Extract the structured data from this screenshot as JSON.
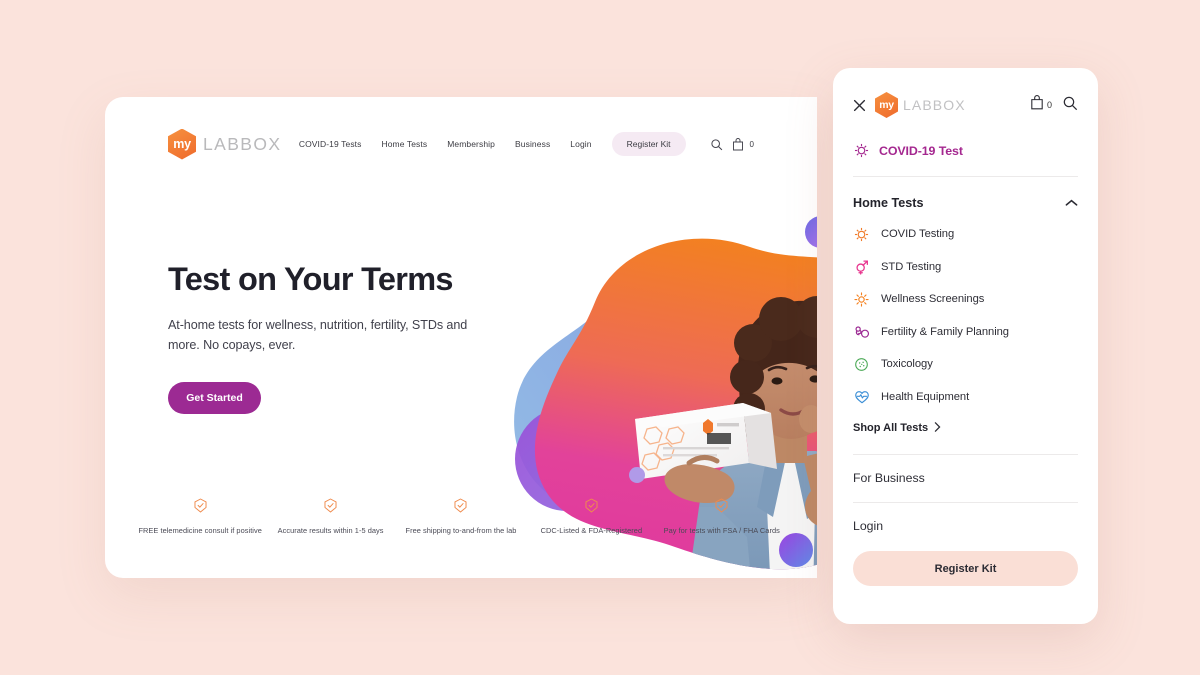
{
  "theme": {
    "page_bg": "#fbe3dc",
    "brand_orange": "#ef6a2c",
    "brand_purple": "#9c2a93",
    "magenta": "#a4278f",
    "pill_pink": "#fadfd6"
  },
  "desktop": {
    "logo": {
      "mark_text": "my",
      "word": "LABBOX"
    },
    "nav": {
      "links": [
        {
          "label": "COVID-19 Tests"
        },
        {
          "label": "Home Tests"
        },
        {
          "label": "Membership"
        },
        {
          "label": "Business"
        },
        {
          "label": "Login"
        }
      ],
      "register_kit": "Register Kit",
      "search_icon": "search-icon",
      "cart_icon": "shopping-bag-icon",
      "cart_count": "0"
    },
    "hero": {
      "title": "Test on Your Terms",
      "subtitle": "At-home tests for wellness, nutrition, fertility, STDs and more. No copays, ever.",
      "cta": "Get Started"
    },
    "features": [
      {
        "icon": "check-shield-icon",
        "text": "FREE telemedicine consult if positive"
      },
      {
        "icon": "check-shield-icon",
        "text": "Accurate results within 1-5 days"
      },
      {
        "icon": "check-shield-icon",
        "text": "Free shipping to-and-from the lab"
      },
      {
        "icon": "check-shield-icon",
        "text": "CDC-Listed & FDA-Registered"
      },
      {
        "icon": "check-shield-icon",
        "text": "Pay for tests with FSA / FHA Cards"
      }
    ]
  },
  "mobile_menu": {
    "close_icon": "close-icon",
    "logo": {
      "mark_text": "my",
      "word": "LABBOX"
    },
    "cart_icon": "shopping-bag-icon",
    "cart_count": "0",
    "search_icon": "search-icon",
    "covid_item": {
      "label": "COVID-19 Test",
      "icon": "virus-icon",
      "color": "#a4278f"
    },
    "section": {
      "title": "Home Tests",
      "chevron": "chevron-up-icon",
      "items": [
        {
          "label": "COVID Testing",
          "icon": "virus-icon",
          "color": "#f07b2a"
        },
        {
          "label": "STD Testing",
          "icon": "gender-symbols-icon",
          "color": "#e8368f"
        },
        {
          "label": "Wellness Screenings",
          "icon": "sun-icon",
          "color": "#f58220"
        },
        {
          "label": "Fertility & Family Planning",
          "icon": "sperm-egg-icon",
          "color": "#9c2a93"
        },
        {
          "label": "Toxicology",
          "icon": "petri-dish-icon",
          "color": "#4caa57"
        },
        {
          "label": "Health Equipment",
          "icon": "heartbeat-icon",
          "color": "#3c8fd6"
        }
      ],
      "shop_all": "Shop All Tests",
      "shop_all_chevron": "chevron-right-icon"
    },
    "business_link": "For Business",
    "login_link": "Login",
    "register_kit_button": "Register Kit"
  }
}
